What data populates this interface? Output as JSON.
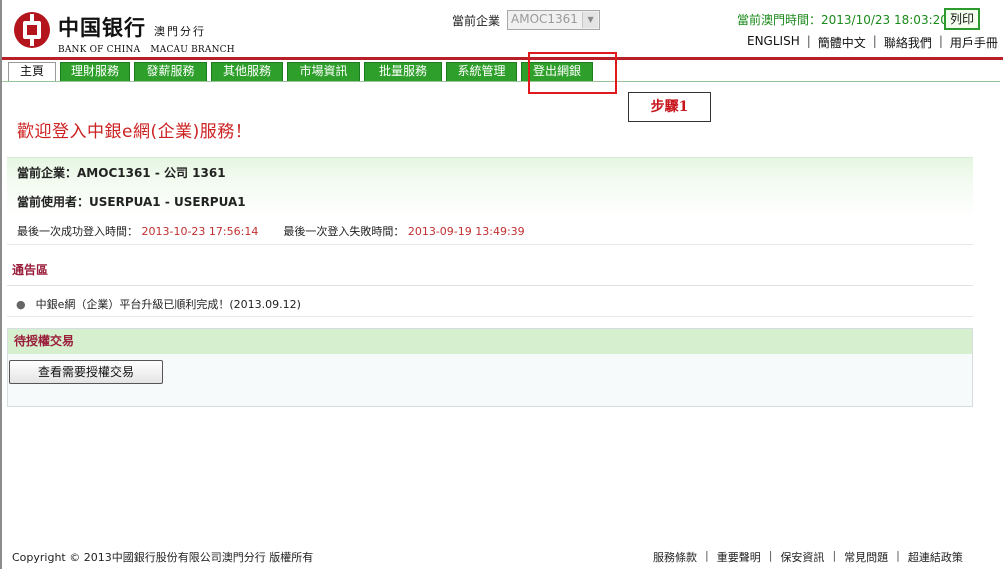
{
  "header": {
    "logo_cn": "中国银行",
    "logo_branch_cn": "澳門分行",
    "logo_en_bank": "BANK OF CHINA",
    "logo_en_branch": "MACAU BRANCH",
    "corp_label": "當前企業",
    "corp_value": "AMOC1361",
    "time_label": "當前澳門時間：",
    "time_value": "2013/10/23 18:03:20",
    "print_label": "列印",
    "links": [
      "ENGLISH",
      "簡體中文",
      "聯絡我們",
      "用戶手冊"
    ],
    "link_separator": "|"
  },
  "tabs": [
    {
      "label": "主頁"
    },
    {
      "label": "理財服務"
    },
    {
      "label": "發薪服務"
    },
    {
      "label": "其他服務"
    },
    {
      "label": "市場資訊"
    },
    {
      "label": "批量服務"
    },
    {
      "label": "系統管理"
    },
    {
      "label": "登出網銀"
    }
  ],
  "annotation": {
    "step_label": "步驟1",
    "highlight_color": "#e0191c"
  },
  "welcome": "歡迎登入中銀e網(企業)服務！",
  "info": {
    "current_corp_label": "當前企業：",
    "current_corp_value": "AMOC1361 - 公司 1361",
    "current_user_label": "當前使用者：",
    "current_user_value": "USERPUA1 - USERPUA1",
    "last_success_label": "最後一次成功登入時間：",
    "last_success_value": "2013-10-23 17:56:14",
    "last_fail_label": "最後一次登入失敗時間：",
    "last_fail_value": "2013-09-19 13:49:39"
  },
  "notice": {
    "title": "通告區",
    "items": [
      "中銀e網（企業）平台升級已順利完成！(2013.09.12)"
    ]
  },
  "pending": {
    "title": "待授權交易",
    "button_label": "查看需要授權交易"
  },
  "footer": {
    "copyright": "Copyright © 2013中國銀行股份有限公司澳門分行 版權所有",
    "links": [
      "服務條款",
      "重要聲明",
      "保安資訊",
      "常見問題",
      "超連結政策"
    ],
    "link_separator": "|"
  },
  "colors": {
    "brand_red": "#b82027",
    "tab_green": "#2e9f2b",
    "time_green": "#1a8a1a",
    "value_red": "#c03030"
  }
}
